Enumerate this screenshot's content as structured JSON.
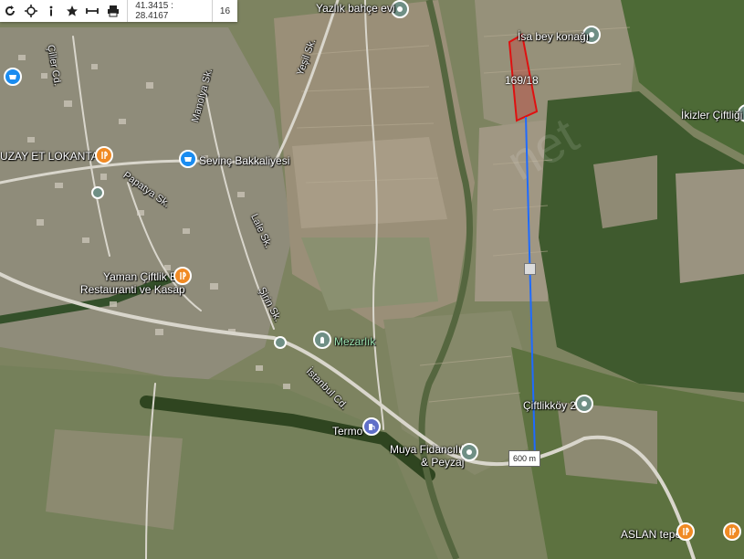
{
  "toolbar": {
    "coordinates": "41.3415 : 28.4167",
    "zoom": "16",
    "icons": [
      "refresh-icon",
      "locate-icon",
      "info-icon",
      "star-icon",
      "measure-icon",
      "print-icon"
    ]
  },
  "parcel": {
    "label": "169/18",
    "color": "#e01010"
  },
  "measurement": {
    "distance": "600 m",
    "line_color": "#1f6bff"
  },
  "places": {
    "yazlik": "Yazlık bahçe evi",
    "isa_bey": "İsa bey konağı",
    "ikizler": "İkizler Çiftliği",
    "uzay": "UZAY ET LOKANTASI",
    "sevinc": "Sevinç Bakkaliyesi",
    "yaman_1": "Yaman Çiftlik Et",
    "yaman_2": "Restauranti ve Kasap",
    "mezarlik": "Mezarlık",
    "ciftlikkoy": "Çiftlikköy 2",
    "termo": "Termo",
    "muya_1": "Muya Fidancılık",
    "muya_2": "& Peyzaj",
    "aslan": "ASLAN tepe"
  },
  "roads": {
    "ciller": "Çiller Cd.",
    "yesil": "Yeşil Sk.",
    "manolya": "Manolya Sk.",
    "papatya": "Papatya Sk.",
    "lale": "Lale Sk.",
    "siirin": "Şirin Sk.",
    "istanbul": "İstanbul Cd."
  },
  "watermark": "net"
}
